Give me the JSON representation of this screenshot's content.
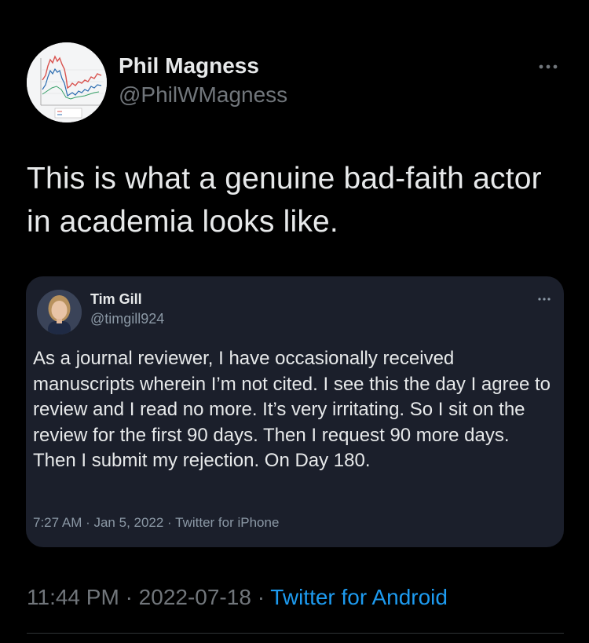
{
  "author": {
    "name": "Phil Magness",
    "handle": "@PhilWMagness"
  },
  "tweet": {
    "text": "This is what a genuine bad-faith actor in academia looks like.",
    "time": "11:44 PM",
    "separator": "·",
    "date": "2022-07-18",
    "source": "Twitter for Android"
  },
  "quoted_tweet": {
    "author_name": "Tim Gill",
    "author_handle": "@timgill924",
    "text": "As a journal reviewer, I have occasionally received manuscripts wherein I’m not cited. I see this the day I agree to review and I read no more. It’s very irritating. So I sit on the review for the first 90 days. Then I request 90 more days. Then I submit my rejection. On Day 180.",
    "meta": "7:27 AM · Jan 5, 2022 · Twitter for iPhone"
  },
  "icons": {
    "more_main": "more-horizontal-icon",
    "more_quote": "more-horizontal-icon"
  },
  "colors": {
    "background": "#000000",
    "card_background": "#1b1f2b",
    "text_primary": "#e7e9ea",
    "text_secondary": "#71767b",
    "link": "#1d9bf0",
    "divider": "#2f3336"
  }
}
